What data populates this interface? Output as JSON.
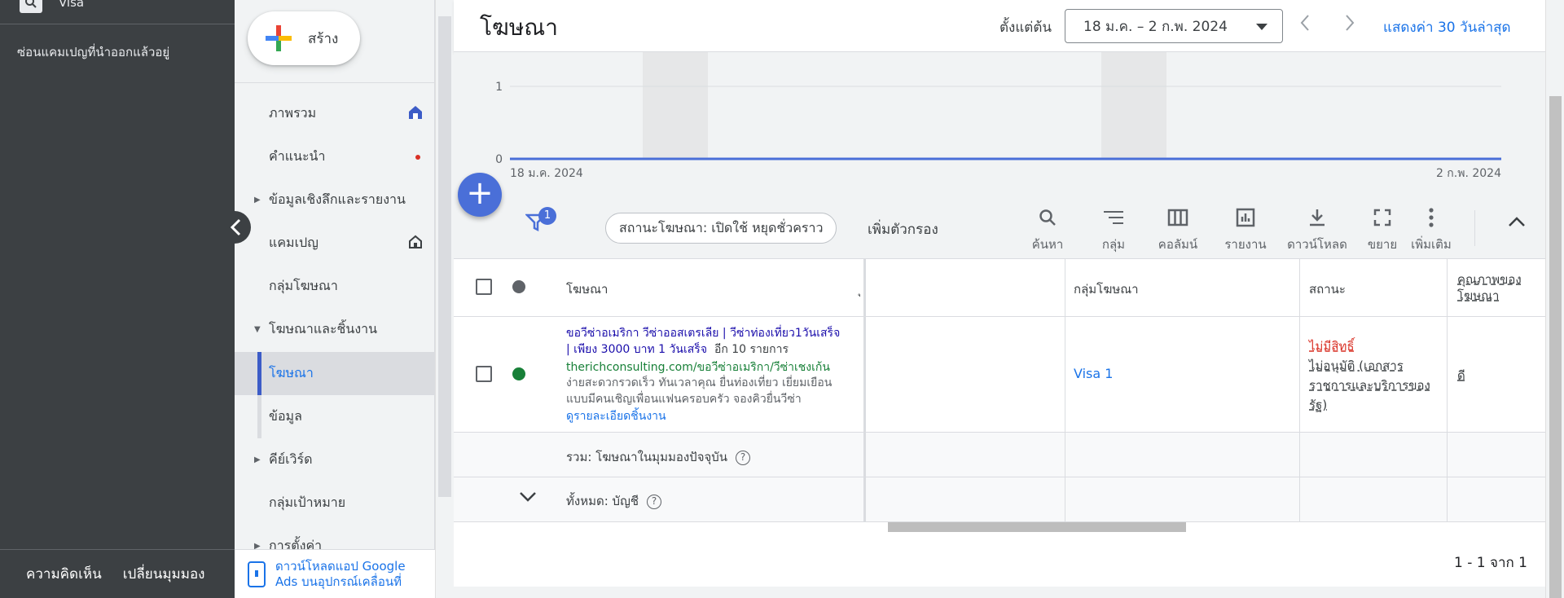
{
  "rail": {
    "account_name": "Visa",
    "hidden_campaigns": "ซ่อนแคมเปญที่นำออกแล้วอยู่",
    "feedback": "ความคิดเห็น",
    "switch_view": "เปลี่ยนมุมมอง"
  },
  "nav": {
    "create_label": "สร้าง",
    "items": [
      {
        "label": "ภาพรวม",
        "icon": "home-icon"
      },
      {
        "label": "คำแนะนำ",
        "icon": "notification-dot"
      },
      {
        "label": "ข้อมูลเชิงลึกและรายงาน"
      },
      {
        "label": "แคมเปญ",
        "icon": "home-outline-icon"
      },
      {
        "label": "กลุ่มโฆษณา"
      },
      {
        "label": "โฆษณาและชิ้นงาน"
      },
      {
        "label": "โฆษณา"
      },
      {
        "label": "ข้อมูล"
      },
      {
        "label": "คีย์เวิร์ด"
      },
      {
        "label": "กลุ่มเป้าหมาย"
      },
      {
        "label": "การตั้งค่า"
      }
    ],
    "download_app": "ดาวน์โหลดแอป Google Ads บนอุปกรณ์เคลื่อนที่"
  },
  "header": {
    "title": "โฆษณา",
    "date_label": "ตั้งแต่ต้น",
    "date_range": "18 ม.ค. – 2 ก.พ. 2024",
    "last30": "แสดงค่า 30 วันล่าสุด"
  },
  "chart_data": {
    "type": "line",
    "y_ticks": [
      "0",
      "1"
    ],
    "ylim": [
      0,
      1
    ],
    "x_start_label": "18 ม.ค. 2024",
    "x_end_label": "2 ก.พ. 2024",
    "series": [
      {
        "values": [
          0,
          0
        ]
      }
    ],
    "line_color": "#4a6fd8"
  },
  "toolbar": {
    "filter_count": "1",
    "filter_chip": "สถานะโฆษณา: เปิดใช้ หยุดชั่วคราว",
    "add_filter": "เพิ่มตัวกรอง",
    "tools": [
      {
        "label": "ค้นหา",
        "icon": "search-icon"
      },
      {
        "label": "กลุ่ม",
        "icon": "segment-icon"
      },
      {
        "label": "คอลัมน์",
        "icon": "columns-icon"
      },
      {
        "label": "รายงาน",
        "icon": "reports-icon"
      },
      {
        "label": "ดาวน์โหลด",
        "icon": "download-icon"
      },
      {
        "label": "ขยาย",
        "icon": "expand-icon"
      },
      {
        "label": "เพิ่มเติม",
        "icon": "more-vert-icon"
      }
    ]
  },
  "table": {
    "headers": {
      "ad": "โฆษณา",
      "partial": "ุ",
      "ad_group": "กลุ่มโฆษณา",
      "status": "สถานะ",
      "ad_quality": "คุณภาพของโฆษณา"
    },
    "row": {
      "title": "ขอวีซ่าอเมริกา วีซ่าออสเตรเลีย | วีซ่าท่องเที่ยว1วันเสร็จ | เพียง 3000 บาท 1 วันเสร็จ",
      "more": "อีก 10 รายการ",
      "url": "therichconsulting.com/ขอวีซ่าอเมริกา/วีซ่าเชงเก้น",
      "description": "ง่ายสะดวกรวดเร็ว ทันเวลาคุณ ยื่นท่องเที่ยว เยี่ยมเยือนแบบมีคนเชิญเพื่อนแฟนครอบครัว จองคิวยื่นวีซ่า",
      "details_link": "ดูรายละเอียดชิ้นงาน",
      "ad_group": "Visa 1",
      "status_main": "ไม่มีสิทธิ์",
      "status_detail": "ไม่อนุมัติ (เอกสารราชการและบริการของรัฐ)",
      "quality": "ดี",
      "status_color": "#188038"
    },
    "summary1": "รวม: โฆษณาในมุมมองปัจจุบัน",
    "summary2": "ทั้งหมด: บัญชี",
    "paging": "1 - 1 จาก 1"
  }
}
